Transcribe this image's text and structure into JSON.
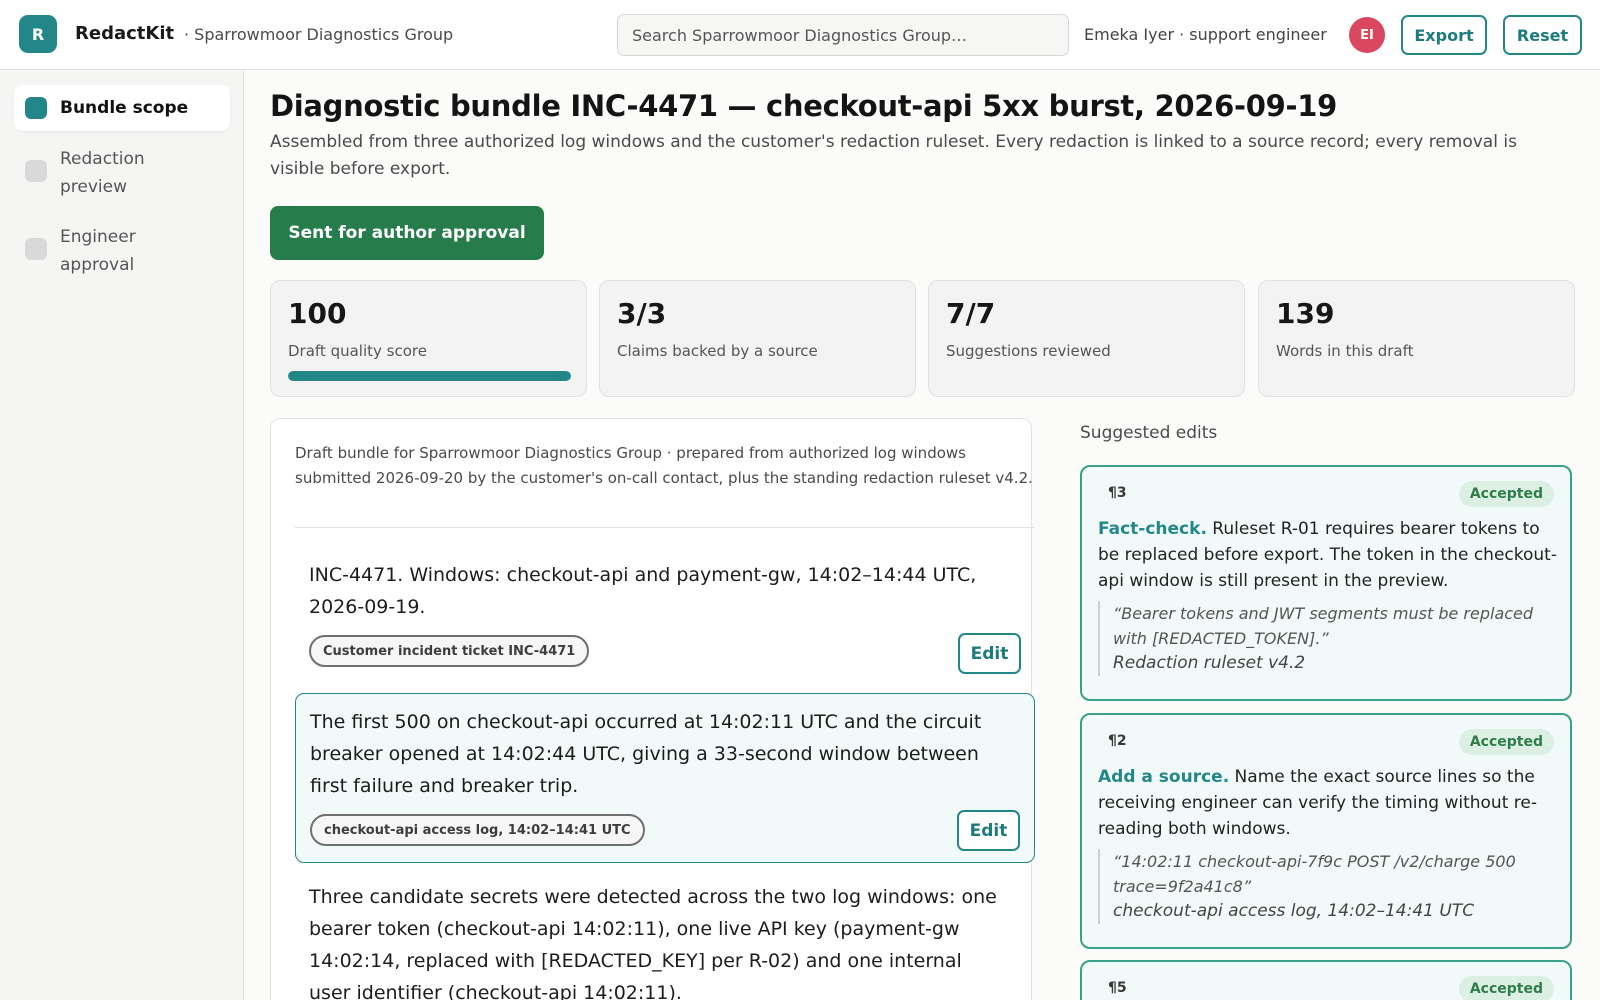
{
  "header": {
    "logo_letter": "R",
    "app_name": "RedactKit",
    "org": "· Sparrowmoor Diagnostics Group",
    "search_placeholder": "Search Sparrowmoor Diagnostics Group…",
    "user": "Emeka Iyer · support engineer",
    "avatar_initials": "EI",
    "export_label": "Export",
    "reset_label": "Reset"
  },
  "sidebar": {
    "items": [
      {
        "label": "Bundle scope",
        "active": true
      },
      {
        "label": "Redaction preview",
        "active": false
      },
      {
        "label": "Engineer approval",
        "active": false
      }
    ]
  },
  "main": {
    "title": "Diagnostic bundle INC-4471 — checkout-api 5xx burst, 2026-09-19",
    "subtitle": "Assembled from three authorized log windows and the customer's redaction ruleset. Every redaction is linked to a source record; every removal is visible before export.",
    "approval_button": "Sent for author approval"
  },
  "stats": [
    {
      "value": "100",
      "caption": "Draft quality score",
      "progress": 1.0
    },
    {
      "value": "3/3",
      "caption": "Claims backed by a source"
    },
    {
      "value": "7/7",
      "caption": "Suggestions reviewed"
    },
    {
      "value": "139",
      "caption": "Words in this draft"
    }
  ],
  "draft": {
    "intro": "Draft bundle for Sparrowmoor Diagnostics Group · prepared from authorized log windows submitted 2026-09-20 by the customer's on-call contact, plus the standing redaction ruleset v4.2.",
    "edit_label": "Edit",
    "paragraphs": [
      {
        "text": "INC-4471. Windows: checkout-api and payment-gw, 14:02–14:44 UTC, 2026-09-19.",
        "source": "Customer incident ticket INC-4471"
      },
      {
        "text": "The first 500 on checkout-api occurred at 14:02:11 UTC and the circuit breaker opened at 14:02:44 UTC, giving a 33-second window between first failure and breaker trip.",
        "source": "checkout-api access log, 14:02–14:41 UTC"
      },
      {
        "text": "Three candidate secrets were detected across the two log windows: one bearer token (checkout-api 14:02:11), one live API key (payment-gw 14:02:14, replaced with [REDACTED_KEY] per R-02) and one internal user identifier (checkout-api 14:02:11)."
      }
    ]
  },
  "suggestions": {
    "heading": "Suggested edits",
    "items": [
      {
        "para": "¶3",
        "status": "Accepted",
        "kind": "Fact-check.",
        "text": " Ruleset R-01 requires bearer tokens to be replaced before export. The token in the checkout-api window is still present in the preview.",
        "quote": "“Bearer tokens and JWT segments must be replaced with [REDACTED_TOKEN].”",
        "quote_source": "Redaction ruleset v4.2"
      },
      {
        "para": "¶2",
        "status": "Accepted",
        "kind": "Add a source.",
        "text": " Name the exact source lines so the receiving engineer can verify the timing without re-reading both windows.",
        "quote": "“14:02:11 checkout-api-7f9c POST /v2/charge 500 trace=9f2a41c8”",
        "quote_source": "checkout-api access log, 14:02–14:41 UTC"
      },
      {
        "para": "¶5",
        "status": "Accepted"
      }
    ]
  },
  "colors": {
    "accent": "#23878a",
    "approve_green": "#267d4b",
    "avatar": "#d9485f",
    "accepted_badge": "#dcefe3"
  }
}
